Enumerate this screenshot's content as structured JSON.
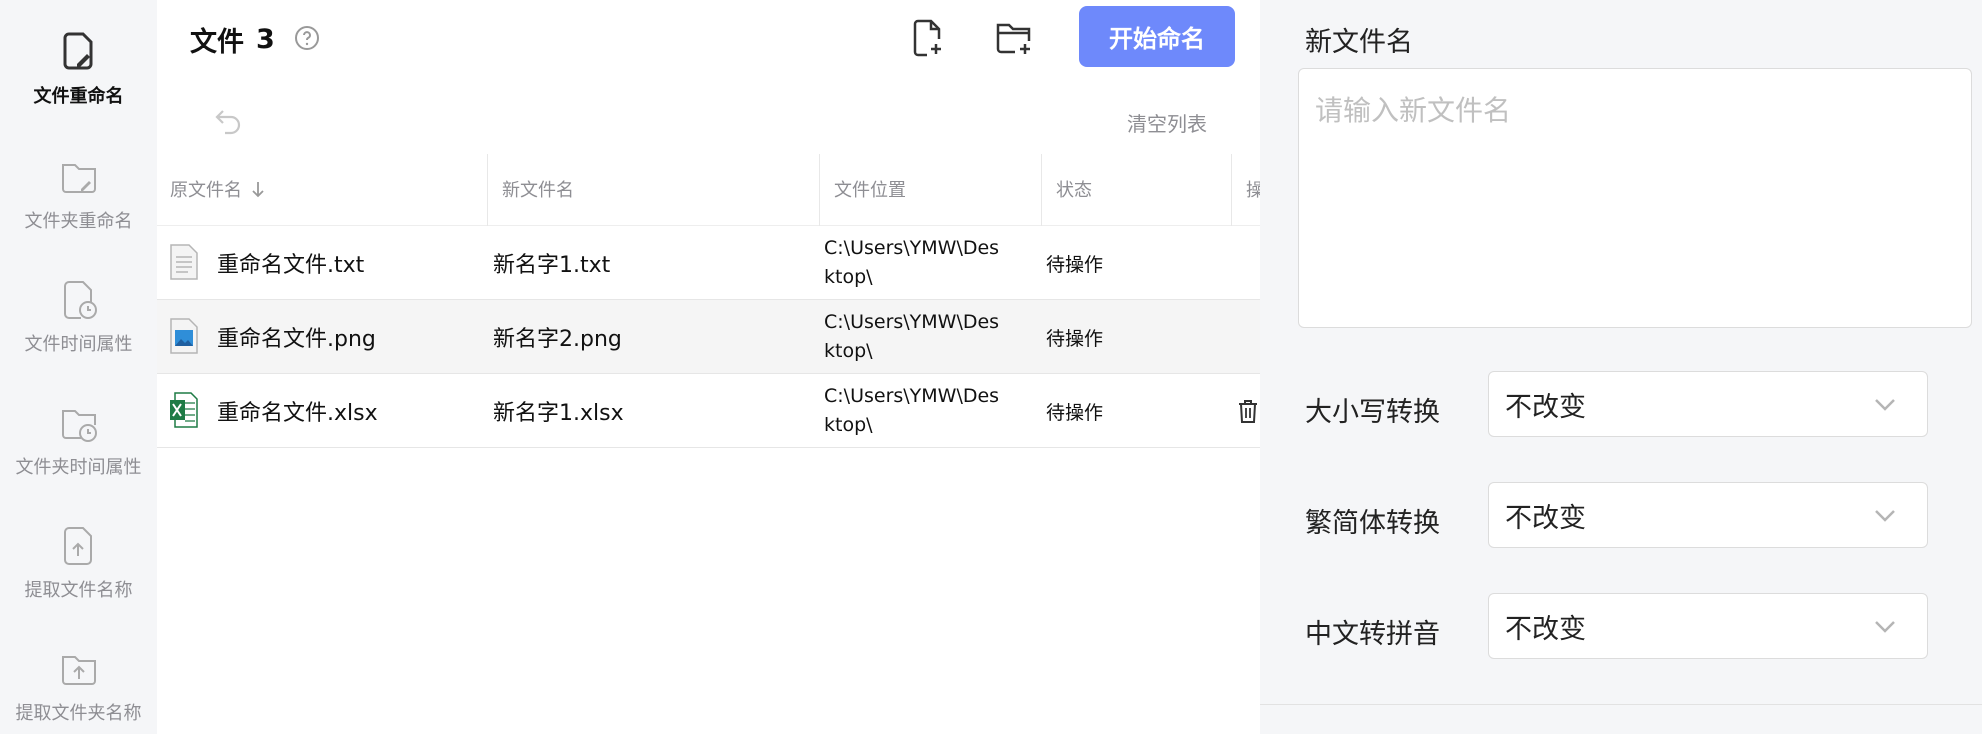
{
  "sidebar": {
    "items": [
      {
        "label": "文件重命名",
        "icon": "file-edit-icon",
        "active": true
      },
      {
        "label": "文件夹重命名",
        "icon": "folder-edit-icon",
        "active": false
      },
      {
        "label": "文件时间属性",
        "icon": "file-clock-icon",
        "active": false
      },
      {
        "label": "文件夹时间属性",
        "icon": "folder-clock-icon",
        "active": false
      },
      {
        "label": "提取文件名称",
        "icon": "file-upload-icon",
        "active": false
      },
      {
        "label": "提取文件夹名称",
        "icon": "folder-upload-icon",
        "active": false
      }
    ]
  },
  "header": {
    "title": "文件",
    "count": "3",
    "start_label": "开始命名",
    "clear_label": "清空列表"
  },
  "table": {
    "columns": [
      "原文件名",
      "新文件名",
      "文件位置",
      "状态",
      "操"
    ],
    "rows": [
      {
        "original": "重命名文件.txt",
        "new_name": "新名字1.txt",
        "location": "C:\\Users\\YMW\\Desktop\\",
        "status": "待操作",
        "type": "txt"
      },
      {
        "original": "重命名文件.png",
        "new_name": "新名字2.png",
        "location": "C:\\Users\\YMW\\Desktop\\",
        "status": "待操作",
        "type": "png"
      },
      {
        "original": "重命名文件.xlsx",
        "new_name": "新名字1.xlsx",
        "location": "C:\\Users\\YMW\\Desktop\\",
        "status": "待操作",
        "type": "xlsx"
      }
    ]
  },
  "panel": {
    "title": "新文件名",
    "input_placeholder": "请输入新文件名",
    "options": [
      {
        "label": "大小写转换",
        "value": "不改变"
      },
      {
        "label": "繁简体转换",
        "value": "不改变"
      },
      {
        "label": "中文转拼音",
        "value": "不改变"
      }
    ]
  },
  "colors": {
    "accent": "#6e89fb",
    "sidebar_bg": "#f5f6f8",
    "panel_bg": "#f5f6f8"
  }
}
